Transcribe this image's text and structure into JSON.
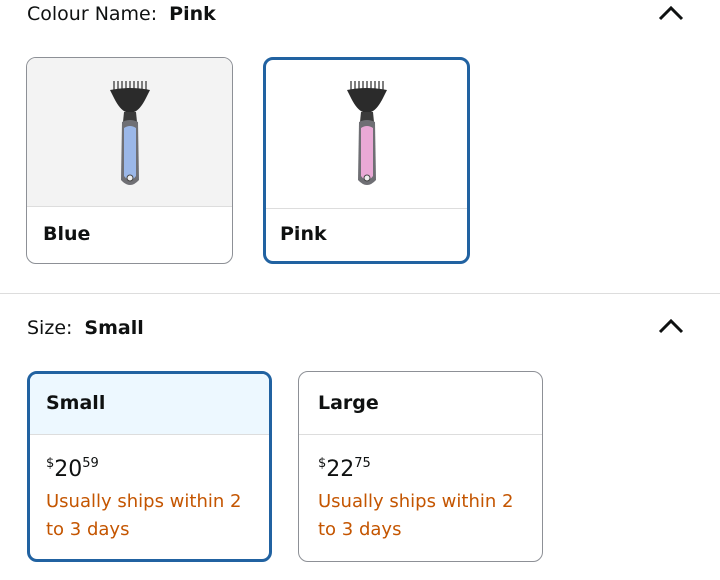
{
  "colour": {
    "label": "Colour Name:",
    "selected": "Pink",
    "options": [
      {
        "name": "Blue",
        "accent": "#9bb7e8"
      },
      {
        "name": "Pink",
        "accent": "#e9a9d6"
      }
    ]
  },
  "size": {
    "label": "Size:",
    "selected": "Small",
    "options": [
      {
        "name": "Small",
        "currency": "$",
        "whole": "20",
        "fraction": "59",
        "shipping": "Usually ships within 2 to 3 days"
      },
      {
        "name": "Large",
        "currency": "$",
        "whole": "22",
        "fraction": "75",
        "shipping": "Usually ships within 2 to 3 days"
      }
    ]
  },
  "colors": {
    "selected_border": "#2162a1",
    "shipping_text": "#c45500",
    "selected_head_bg": "#edf8ff"
  },
  "icons": [
    "chevron-up-icon",
    "chevron-up-icon"
  ]
}
